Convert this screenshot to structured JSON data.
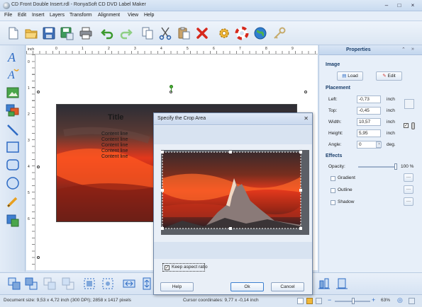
{
  "window": {
    "title": "CD Front Double Insert.rdl - RonyaSoft CD DVD Label Maker",
    "minimize": "–",
    "maximize": "□",
    "close": "×"
  },
  "menu": [
    "File",
    "Edit",
    "Insert",
    "Layers",
    "Transform",
    "Alignment",
    "View",
    "Help"
  ],
  "toolbar_icons": [
    "new-icon",
    "open-folder-icon",
    "save-icon",
    "save-as-icon",
    "print-icon",
    "undo-icon",
    "redo-icon",
    "copy-icon",
    "cut-icon",
    "paste-icon",
    "delete-icon",
    "settings-gear-icon",
    "help-lifebuoy-icon",
    "web-globe-icon",
    "register-key-icon"
  ],
  "left_tools": [
    "text-tool-icon",
    "curved-text-tool-icon",
    "image-tool-icon",
    "collage-tool-icon",
    "line-tool-icon",
    "rectangle-tool-icon",
    "rounded-rectangle-tool-icon",
    "ellipse-tool-icon",
    "pencil-tool-icon",
    "autofill-tool-icon"
  ],
  "ruler": {
    "unit": "inch",
    "h_marks": [
      "0",
      "1",
      "2",
      "3",
      "4",
      "5",
      "6",
      "7",
      "8",
      "9"
    ],
    "v_marks": [
      "0",
      "1",
      "2",
      "3",
      "4",
      "5",
      "6"
    ]
  },
  "cover": {
    "title": "Title",
    "content_lines": [
      "Content line",
      "Content line",
      "Content line",
      "Content line",
      "Content line"
    ]
  },
  "properties": {
    "header": "Properties",
    "image_section": "Image",
    "load_button": "Load",
    "edit_button": "Edit",
    "placement_section": "Placement",
    "left_label": "Left:",
    "left_value": "-0,73",
    "top_label": "Top:",
    "top_value": "-0,45",
    "width_label": "Width:",
    "width_value": "10,57",
    "height_label": "Height:",
    "height_value": "5,95",
    "angle_label": "Angle:",
    "angle_value": "0",
    "unit_inch": "inch",
    "unit_deg": "deg.",
    "effects_section": "Effects",
    "opacity_label": "Opacity:",
    "opacity_value": "100 %",
    "opacity_level": 1.0,
    "gradient_label": "Gradient",
    "outline_label": "Outline",
    "shadow_label": "Shadow"
  },
  "dialog": {
    "title": "Specify the Crop Area",
    "keep_aspect_label": "Keep aspect ratio",
    "keep_aspect_checked": true,
    "help_button": "Help",
    "ok_button": "Ok",
    "cancel_button": "Cancel"
  },
  "bottom_icons": [
    "bring-to-front-icon",
    "send-to-back-icon",
    "bring-forward-icon",
    "send-backward-icon",
    "align-left-icon",
    "align-center-icon",
    "flip-horizontal-icon",
    "flip-vertical-icon",
    "align-bottom-icon",
    "distribute-icon"
  ],
  "status": {
    "document_size": "Document size: 9,53 x 4,72 inch (300 DPI); 2858 x 1417 pixels",
    "cursor": "Cursor coordinates: 9,77 x -0,14 inch",
    "zoom": "63%"
  },
  "colors": {
    "accent": "#1b3f6b",
    "toolbar_bg": "#dbe6f3",
    "sunset_red": "#e2381c"
  }
}
